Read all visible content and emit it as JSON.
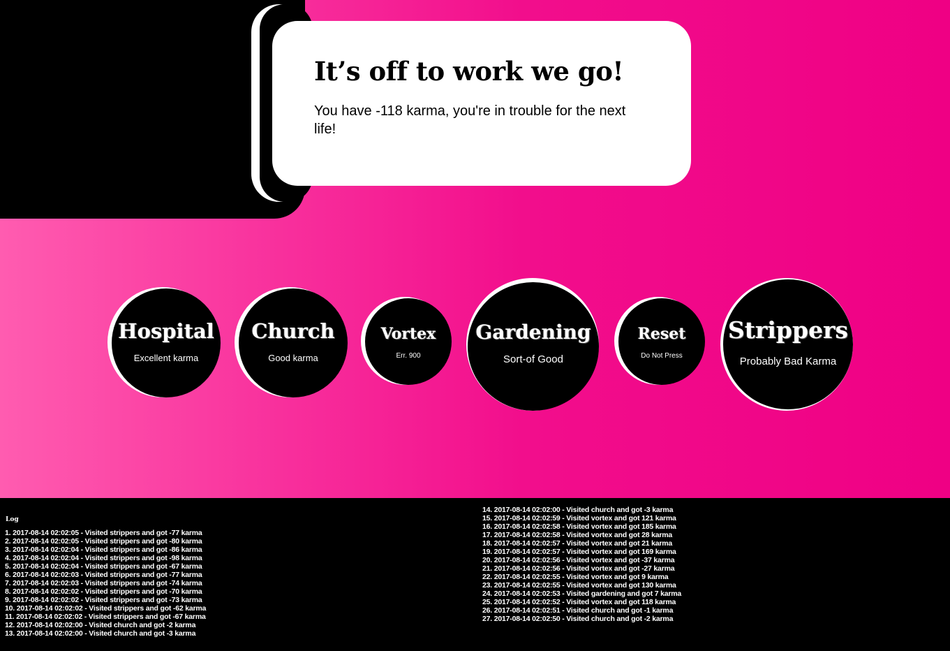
{
  "hero": {
    "title": "It’s off to work we go!",
    "message": "You have -118 karma, you're in trouble for the next life!"
  },
  "destinations": [
    {
      "name": "Hospital",
      "description": "Excellent karma"
    },
    {
      "name": "Church",
      "description": "Good karma"
    },
    {
      "name": "Vortex",
      "description": "Err. 900"
    },
    {
      "name": "Gardening",
      "description": "Sort-of Good"
    },
    {
      "name": "Reset",
      "description": "Do Not Press"
    },
    {
      "name": "Strippers",
      "description": "Probably Bad Karma"
    }
  ],
  "log": {
    "title": "Log",
    "entries": [
      "1. 2017-08-14 02:02:05 - Visited strippers and got -77 karma",
      "2. 2017-08-14 02:02:05 - Visited strippers and got -80 karma",
      "3. 2017-08-14 02:02:04 - Visited strippers and got -86 karma",
      "4. 2017-08-14 02:02:04 - Visited strippers and got -98 karma",
      "5. 2017-08-14 02:02:04 - Visited strippers and got -67 karma",
      "6. 2017-08-14 02:02:03 - Visited strippers and got -77 karma",
      "7. 2017-08-14 02:02:03 - Visited strippers and got -74 karma",
      "8. 2017-08-14 02:02:02 - Visited strippers and got -70 karma",
      "9. 2017-08-14 02:02:02 - Visited strippers and got -73 karma",
      "10. 2017-08-14 02:02:02 - Visited strippers and got -62 karma",
      "11. 2017-08-14 02:02:02 - Visited strippers and got -67 karma",
      "12. 2017-08-14 02:02:00 - Visited church and got -2 karma",
      "13. 2017-08-14 02:02:00 - Visited church and got -3 karma",
      "14. 2017-08-14 02:02:00 - Visited church and got -3 karma",
      "15. 2017-08-14 02:02:59 - Visited vortex and got 121 karma",
      "16. 2017-08-14 02:02:58 - Visited vortex and got 185 karma",
      "17. 2017-08-14 02:02:58 - Visited vortex and got 28 karma",
      "18. 2017-08-14 02:02:57 - Visited vortex and got 21 karma",
      "19. 2017-08-14 02:02:57 - Visited vortex and got 169 karma",
      "20. 2017-08-14 02:02:56 - Visited vortex and got -37 karma",
      "21. 2017-08-14 02:02:56 - Visited vortex and got -27 karma",
      "22. 2017-08-14 02:02:55 - Visited vortex and got 9 karma",
      "23. 2017-08-14 02:02:55 - Visited vortex and got 130 karma",
      "24. 2017-08-14 02:02:53 - Visited gardening and got 7 karma",
      "25. 2017-08-14 02:02:52 - Visited vortex and got 118 karma",
      "26. 2017-08-14 02:02:51 - Visited church and got -1 karma",
      "27. 2017-08-14 02:02:50 - Visited church and got -2 karma"
    ]
  }
}
